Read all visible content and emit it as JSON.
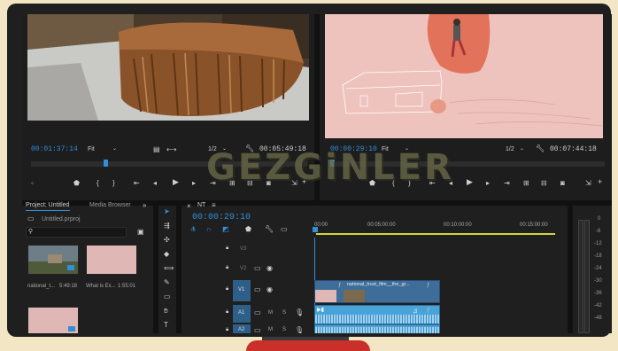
{
  "watermark": "GEZGiNLER",
  "source_monitor": {
    "timecode": "00:01:37:14",
    "fit": "Fit",
    "resolution": "1/2",
    "duration": "00:05:49:18"
  },
  "program_monitor": {
    "timecode": "00:00:29:10",
    "fit": "Fit",
    "resolution": "1/2",
    "duration": "00:07:44:18"
  },
  "project_panel": {
    "tab_project": "Project: Untitled",
    "tab_media": "Media Browser",
    "project_file": "Untitled.prproj",
    "items": [
      {
        "name": "national_t...",
        "duration": "5:49:18"
      },
      {
        "name": "What is Ex...",
        "duration": "1:55:01"
      }
    ]
  },
  "timeline": {
    "sequence_name": "NT",
    "timecode": "00:00:29:10",
    "ruler": [
      "00:00",
      "00:05:00:00",
      "00:10:00:00",
      "00:15:00:00"
    ],
    "tracks": [
      "V3",
      "V2",
      "V1",
      "A1",
      "A2"
    ],
    "clip_label": "national_trust_film__the_gr..."
  },
  "audio_meter": {
    "scale": [
      "0",
      "-6",
      "-12",
      "-18",
      "-24",
      "-30",
      "-36",
      "-42",
      "-48"
    ]
  },
  "colors": {
    "accent_blue": "#2f8fdd",
    "program_bg": "#eec3bd",
    "clip_video": "#3f6d9a",
    "clip_audio": "#4aa3d8"
  }
}
